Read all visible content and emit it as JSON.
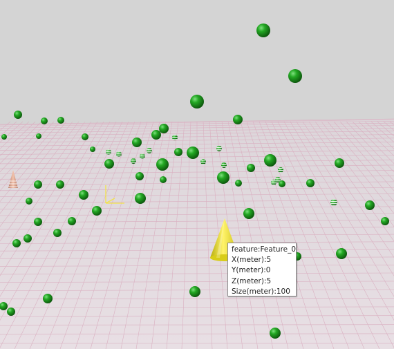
{
  "scene": {
    "background_color": "#d4d4d4",
    "floor_color": "#e7dde2",
    "grid_color": "#d7a9bb",
    "sphere_color": "#1e9b1e",
    "selected_cone_color": "#e6dc1c",
    "other_cone_color": "#e4a78f",
    "axis_color": "#f0e040"
  },
  "tooltip": {
    "feature": "feature:Feature_0",
    "x": "X(meter):5",
    "y": "Y(meter):0",
    "z": "Z(meter):5",
    "size": "Size(meter):100"
  }
}
